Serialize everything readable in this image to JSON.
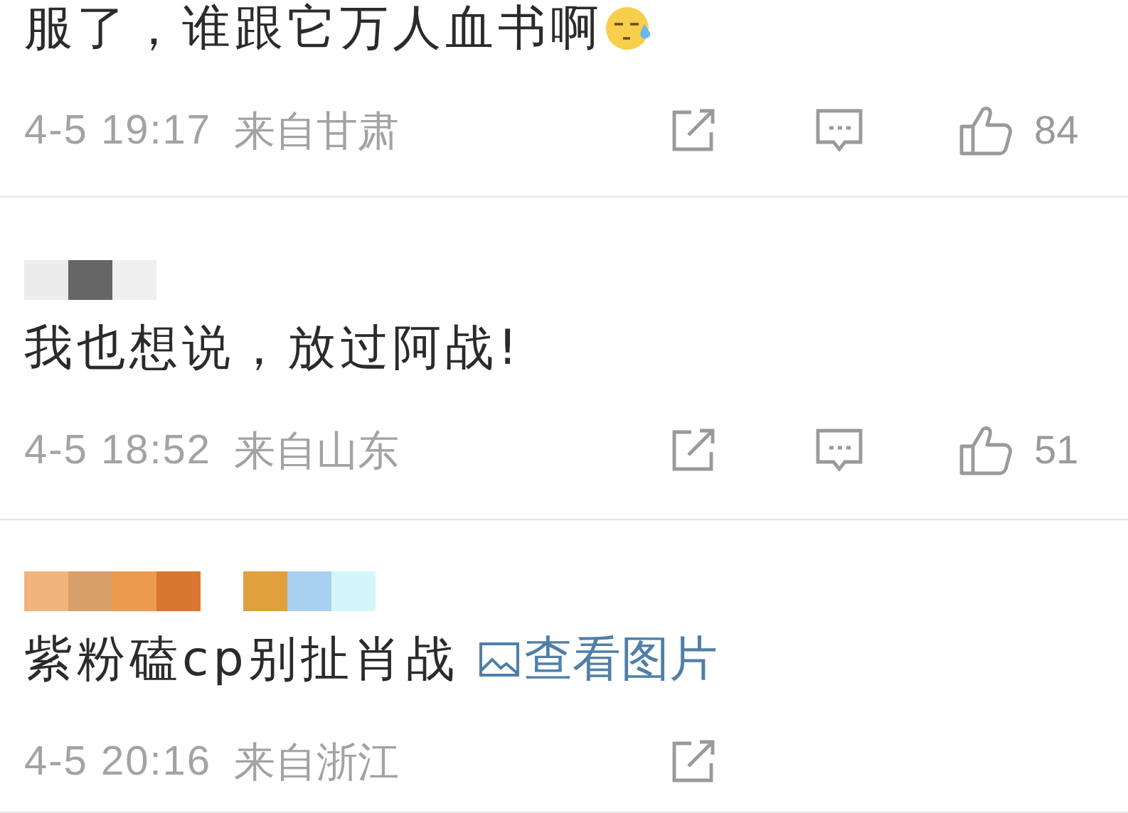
{
  "comments": [
    {
      "text": "服了，谁跟它万人血书啊",
      "emoji": true,
      "time": "4-5 19:17",
      "location": "来自甘肃",
      "actions": [
        {
          "kind": "share"
        },
        {
          "kind": "comment"
        },
        {
          "kind": "like",
          "count": "84"
        }
      ]
    },
    {
      "redaction": [
        {
          "tiles": [
            {
              "color": "#ececec"
            },
            {
              "color": "#666666"
            },
            {
              "color": "#efefef"
            }
          ]
        }
      ],
      "text": "我也想说，放过阿战!",
      "emoji": false,
      "time": "4-5 18:52",
      "location": "来自山东",
      "actions": [
        {
          "kind": "share"
        },
        {
          "kind": "comment"
        },
        {
          "kind": "like",
          "count": "51"
        }
      ]
    },
    {
      "redaction": [
        {
          "tiles": [
            {
              "color": "#f0b47c"
            },
            {
              "color": "#d9a06c"
            },
            {
              "color": "#ee9a4c"
            },
            {
              "color": "#d8772f"
            }
          ]
        },
        {
          "tiles": [
            {
              "color": "#e0a03c"
            },
            {
              "color": "#a9d0ee"
            },
            {
              "color": "#d4f6fa"
            }
          ]
        }
      ],
      "text": "紫粉磕cp别扯肖战",
      "emoji": false,
      "link": "查看图片",
      "time": "4-5 20:16",
      "location": "来自浙江",
      "actions": [
        {
          "kind": "share"
        }
      ]
    }
  ]
}
